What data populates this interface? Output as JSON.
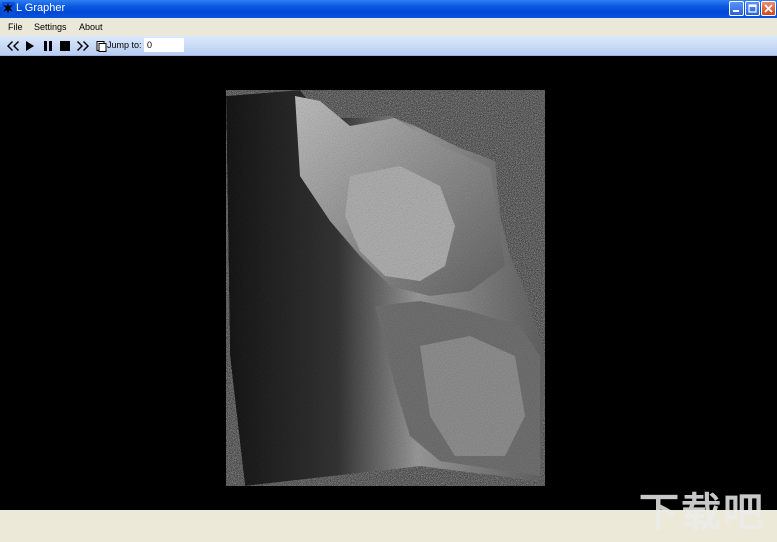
{
  "window": {
    "title": "L Grapher"
  },
  "menu": {
    "file": "File",
    "settings": "Settings",
    "about": "About"
  },
  "toolbar": {
    "jump_label": "Jump to:",
    "jump_value": "0"
  },
  "icons": [
    "app-icon",
    "minimize-icon",
    "maximize-icon",
    "close-icon",
    "rewind-icon",
    "play-icon",
    "pause-icon",
    "stop-icon",
    "fast-forward-icon",
    "jump-icon"
  ],
  "watermark": "下载吧"
}
